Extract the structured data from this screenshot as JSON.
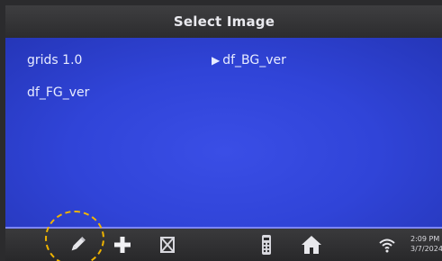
{
  "window": {
    "title": "Select Image"
  },
  "images": [
    {
      "label": "grids 1.0",
      "selected": false
    },
    {
      "label": "df_BG_ver",
      "selected": true
    },
    {
      "label": "df_FG_ver",
      "selected": false
    }
  ],
  "selected_marker": "▶",
  "toolbar": {
    "icons": [
      "pencil-icon",
      "plus-icon",
      "delete-icon",
      "remote-control-icon",
      "home-icon",
      "wifi-icon"
    ],
    "time": "2:09 PM",
    "date": "3/7/2024"
  },
  "colors": {
    "content_bg": "#3044d8",
    "titlebar_bg": "#333335",
    "highlight_circle": "#f0b400"
  }
}
